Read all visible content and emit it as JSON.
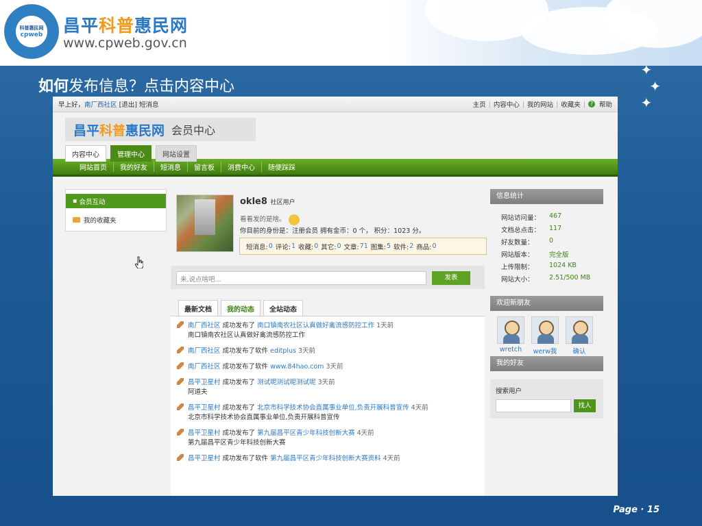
{
  "slide": {
    "brand_cn_a": "昌平",
    "brand_cn_b": "科普",
    "brand_cn_c": "惠民网",
    "brand_url": "www.cpweb.gov.cn",
    "seal_text_top": "科普惠民网",
    "seal_text_bottom": "cpweb",
    "heading_bold": "如何",
    "heading_rest": "发布信息？点击内容中心",
    "page_label": "Page · 15"
  },
  "colors": {
    "brand_blue": "#2a78c6",
    "brand_orange": "#f09b1e",
    "brand_green": "#3b9a1e",
    "nav_green": "#4f9a1c",
    "slide_blue": "#1f5c97"
  },
  "topbar": {
    "greeting": "早上好，",
    "user_link": "南厂西社区",
    "logout": "[退出]",
    "messages": "短消息",
    "links": [
      "主页",
      "内容中心",
      "我的网站",
      "收藏夹"
    ],
    "help": "帮助"
  },
  "site": {
    "logo_a": "昌平",
    "logo_b": "科普",
    "logo_c": "惠民网",
    "logo_sub": "会员中心",
    "tabs": [
      "内容中心",
      "管理中心",
      "网站设置"
    ],
    "nav": [
      "网站首页",
      "我的好友",
      "短消息",
      "留言板",
      "消费中心",
      "随便踩踩"
    ]
  },
  "left_menu": {
    "items": [
      "会员互动",
      "我的收藏夹"
    ]
  },
  "profile": {
    "name": "okle8",
    "role": "社区用户",
    "status": "看看发的是啥。",
    "identity": "你目前的身份是：注册会员  拥有金币：0 个， 积分：1023 分。",
    "stats": [
      {
        "label": "短消息:",
        "value": "0"
      },
      {
        "label": "评论:",
        "value": "1"
      },
      {
        "label": "收藏:",
        "value": "0"
      },
      {
        "label": "其它:",
        "value": "0"
      },
      {
        "label": "文章:",
        "value": "71"
      },
      {
        "label": "图集:",
        "value": "5"
      },
      {
        "label": "软件:",
        "value": "2"
      },
      {
        "label": "商品:",
        "value": "0"
      }
    ]
  },
  "post": {
    "placeholder": "来,说点啥吧...",
    "button": "发表"
  },
  "feed": {
    "tabs": [
      "最新文档",
      "我的动态",
      "全站动态"
    ],
    "items": [
      {
        "user": "南厂西社区",
        "action": "成功发布了",
        "target": "南口镇南农社区认真做好禽流感防控工作",
        "ago": "1天前",
        "detail": "南口镇南农社区认真做好禽流感防控工作"
      },
      {
        "user": "南厂西社区",
        "action": "成功发布了软件",
        "target": "editplus",
        "ago": "3天前",
        "detail": ""
      },
      {
        "user": "南厂西社区",
        "action": "成功发布了软件",
        "target": "www.84hao.com",
        "ago": "3天前",
        "detail": ""
      },
      {
        "user": "昌平卫星村",
        "action": "成功发布了",
        "target": "测试呢测试呢测试呢",
        "ago": "3天前",
        "detail": "阿道夫"
      },
      {
        "user": "昌平卫星村",
        "action": "成功发布了",
        "target": "北京市科学技术协会直属事业单位,负责开展科普宣传",
        "ago": "4天前",
        "detail": "北京市科学技术协会直属事业单位,负责开展科普宣传"
      },
      {
        "user": "昌平卫星村",
        "action": "成功发布了",
        "target": "第九届昌平区青少年科技创新大赛",
        "ago": "4天前",
        "detail": "第九届昌平区青少年科技创新大赛"
      },
      {
        "user": "昌平卫星村",
        "action": "成功发布了软件",
        "target": "第九届昌平区青少年科技创新大赛资料",
        "ago": "4天前",
        "detail": ""
      }
    ]
  },
  "sidebar": {
    "stats_title": "信息统计",
    "stats": [
      {
        "k": "网站访问量：",
        "v": "467"
      },
      {
        "k": "文档总点击：",
        "v": "117"
      },
      {
        "k": "好友数量：",
        "v": "0"
      },
      {
        "k": "网站版本：",
        "v": "完全版"
      },
      {
        "k": "上传限制：",
        "v": "1024 KB"
      },
      {
        "k": "网站大小：",
        "v": "2.51/500 MB"
      }
    ],
    "welcome_title": "欢迎新朋友",
    "friends": [
      "wretch",
      "werw我",
      "确认"
    ],
    "my_friends_title": "我的好友",
    "search_label": "搜索用户",
    "search_button": "找人"
  }
}
